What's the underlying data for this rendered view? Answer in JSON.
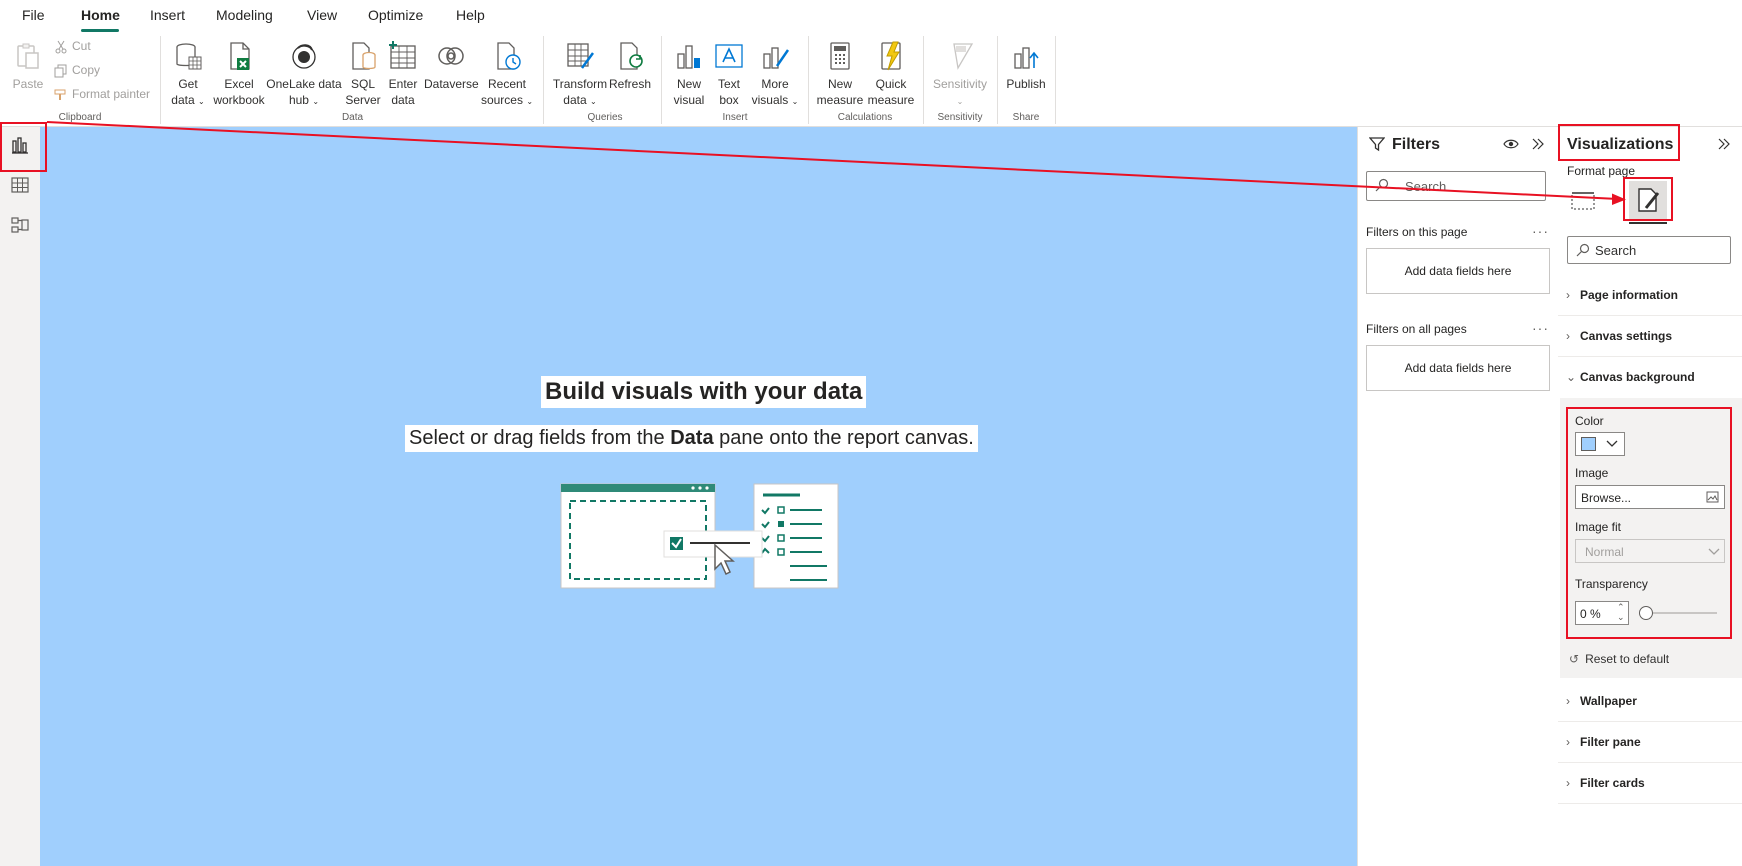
{
  "menu": {
    "items": [
      "File",
      "Home",
      "Insert",
      "Modeling",
      "View",
      "Optimize",
      "Help"
    ],
    "active": "Home"
  },
  "ribbon": {
    "clipboard": {
      "paste": "Paste",
      "cut": "Cut",
      "copy": "Copy",
      "format_painter": "Format painter",
      "group": "Clipboard"
    },
    "data": {
      "get_data": [
        "Get",
        "data"
      ],
      "excel": [
        "Excel",
        "workbook"
      ],
      "onelake": [
        "OneLake data",
        "hub"
      ],
      "sql": [
        "SQL",
        "Server"
      ],
      "enter": [
        "Enter",
        "data"
      ],
      "dataverse": "Dataverse",
      "recent": [
        "Recent",
        "sources"
      ],
      "group": "Data"
    },
    "queries": {
      "transform": [
        "Transform",
        "data"
      ],
      "refresh": "Refresh",
      "group": "Queries"
    },
    "insert": {
      "new_visual": [
        "New",
        "visual"
      ],
      "text_box": [
        "Text",
        "box"
      ],
      "more_visuals": [
        "More",
        "visuals"
      ],
      "group": "Insert"
    },
    "calculations": {
      "new_measure": [
        "New",
        "measure"
      ],
      "quick_measure": [
        "Quick",
        "measure"
      ],
      "group": "Calculations"
    },
    "sensitivity": {
      "label": "Sensitivity",
      "group": "Sensitivity"
    },
    "share": {
      "publish": "Publish",
      "group": "Share"
    }
  },
  "canvas": {
    "background_color": "#a0cffd",
    "title": "Build visuals with your data",
    "subtitle_pre": "Select or drag fields from the ",
    "subtitle_bold": "Data",
    "subtitle_post": " pane onto the report canvas."
  },
  "filters": {
    "title": "Filters",
    "search_placeholder": "Search",
    "on_this_page": "Filters on this page",
    "on_all_pages": "Filters on all pages",
    "add_fields": "Add data fields here",
    "dots": "···"
  },
  "visualizations": {
    "title": "Visualizations",
    "format_page": "Format page",
    "search_placeholder": "Search",
    "sections": {
      "page_information": "Page information",
      "canvas_settings": "Canvas settings",
      "canvas_background": "Canvas background",
      "wallpaper": "Wallpaper",
      "filter_pane": "Filter pane",
      "filter_cards": "Filter cards"
    },
    "background": {
      "color_label": "Color",
      "color_value": "#a0cffd",
      "image_label": "Image",
      "image_value": "Browse...",
      "image_fit_label": "Image fit",
      "image_fit_value": "Normal",
      "transparency_label": "Transparency",
      "transparency_value": "0 %",
      "transparency_level": 0,
      "reset": "Reset to default"
    }
  },
  "colors": {
    "accent": "#117865",
    "annotation": "#e81123"
  }
}
